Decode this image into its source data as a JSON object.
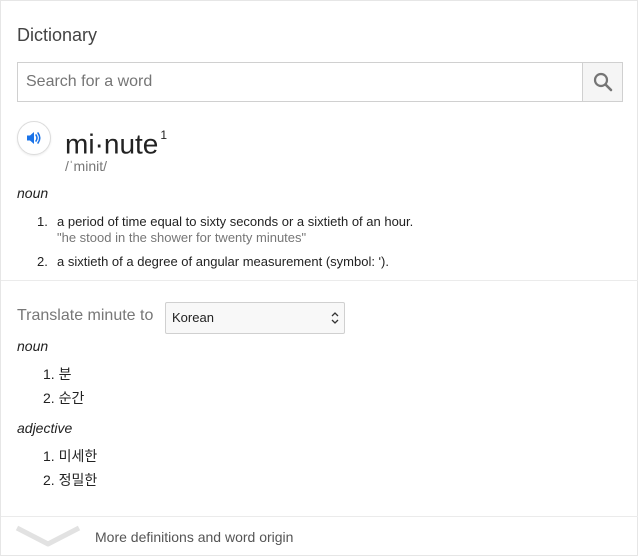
{
  "dictionary": {
    "title": "Dictionary",
    "search": {
      "placeholder": "Search for a word",
      "value": ""
    },
    "entry": {
      "word": "mi·nute",
      "superscript": "1",
      "phonetic": "/ˈminit/",
      "part_of_speech": "noun",
      "definitions": [
        {
          "num": "1.",
          "text": "a period of time equal to sixty seconds or a sixtieth of an hour.",
          "example": "\"he stood in the shower for twenty minutes\""
        },
        {
          "num": "2.",
          "text": "a sixtieth of a degree of angular measurement (symbol: ʹ).",
          "example": ""
        }
      ]
    },
    "translate": {
      "label": "Translate minute to",
      "selected_language": "Korean",
      "groups": [
        {
          "part_of_speech": "noun",
          "items": [
            "1. 분",
            "2. 순간"
          ]
        },
        {
          "part_of_speech": "adjective",
          "items": [
            "1. 미세한",
            "2. 정밀한"
          ]
        }
      ]
    },
    "footer": {
      "more_label": "More definitions and word origin"
    }
  },
  "colors": {
    "accent": "#1a73e8",
    "icon_gray": "#757575",
    "muted_text": "#777777"
  }
}
